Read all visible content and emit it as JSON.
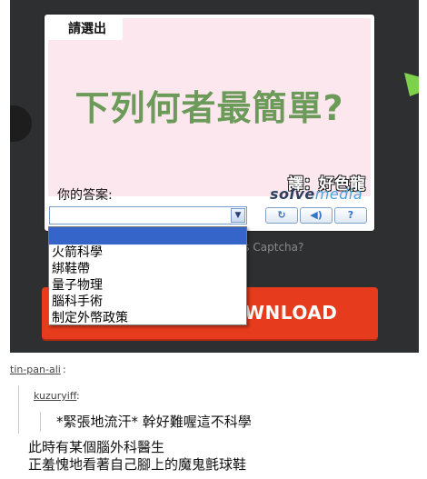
{
  "captcha": {
    "prompt_tab": "請選出",
    "question": "下列何者最簡單?",
    "translator_note": "譯：好色龍",
    "answer_label": "你的答案:",
    "brand_solve": "solve",
    "brand_media": "media",
    "dropdown_options": [
      "",
      "火箭科學",
      "綁鞋帶",
      "量子物理",
      "腦科手術",
      "制定外幣政策"
    ],
    "buttons": [
      {
        "icon": "refresh-icon",
        "glyph": "↻"
      },
      {
        "icon": "audio-icon",
        "glyph": "◀)"
      },
      {
        "icon": "help-icon",
        "glyph": "?"
      }
    ],
    "what_is_text": "is Captcha?"
  },
  "download": {
    "label": "WNLOAD"
  },
  "post": {
    "reblog_user": "tin-pan-ali",
    "original_user": "kuzuryiff",
    "quote": "*緊張地流汗* 幹好難喔這不科學",
    "body_line1": "此時有某個腦外科醫生",
    "body_line2": "正羞愧地看著自己腳上的魔鬼氈球鞋"
  },
  "colors": {
    "page_bg": "#2e2f31",
    "captcha_bg": "#fde7ef",
    "question_green": "#6b9a59",
    "select_highlight": "#3665c9",
    "download_red": "#e73b1d"
  }
}
